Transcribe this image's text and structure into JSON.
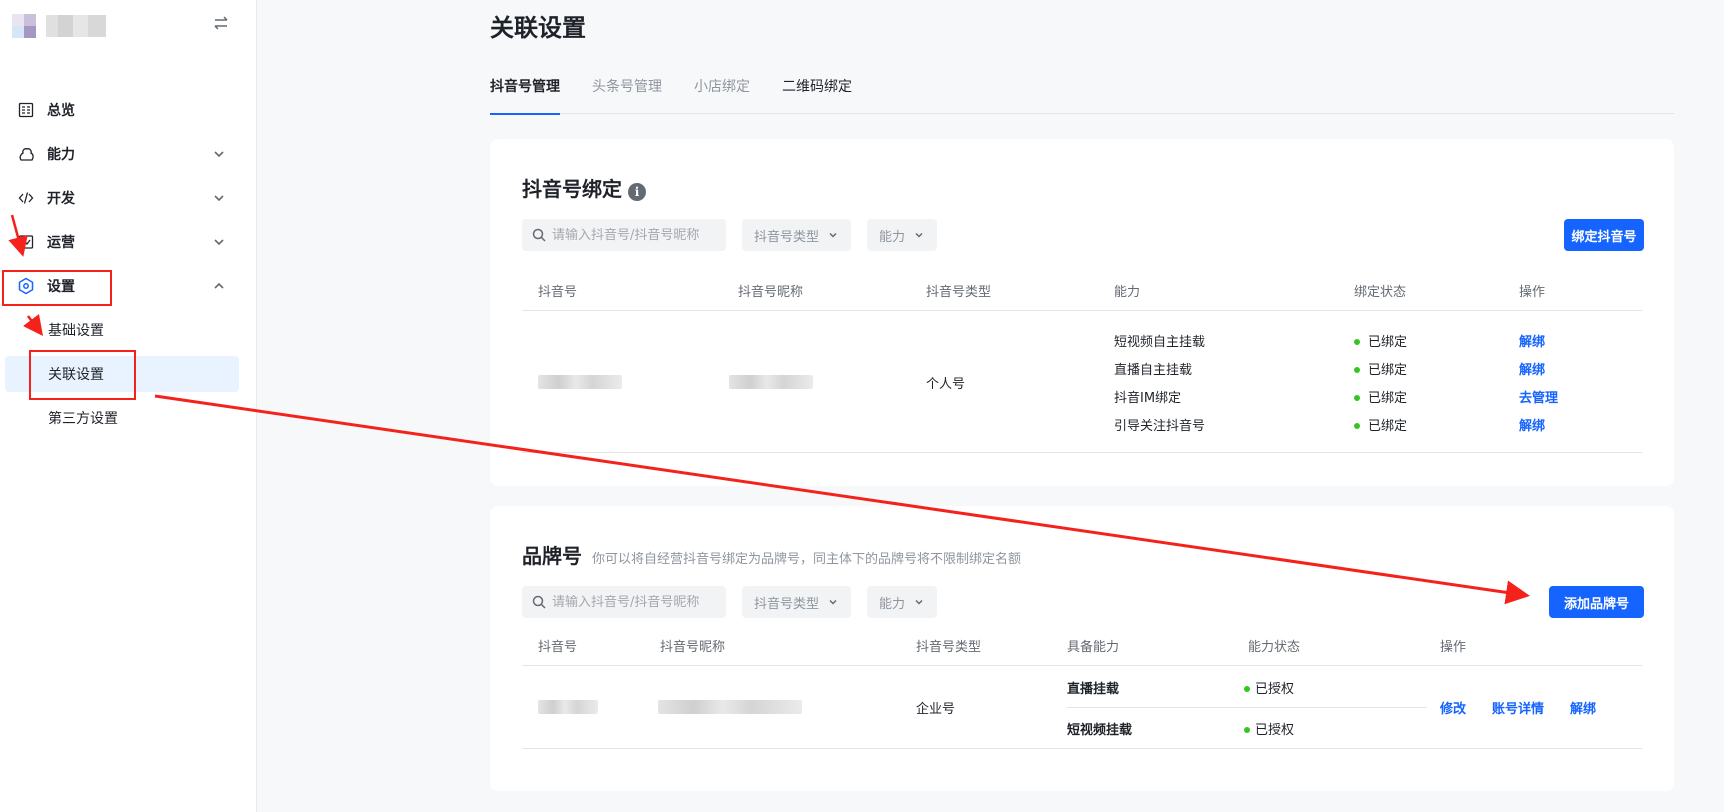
{
  "sidebar": {
    "collapse_icon": "swap-arrows-icon",
    "nav": [
      {
        "label": "总览",
        "icon": "dashboard-icon"
      },
      {
        "label": "能力",
        "icon": "ability-icon"
      },
      {
        "label": "开发",
        "icon": "code-icon"
      },
      {
        "label": "运营",
        "icon": "operation-icon"
      },
      {
        "label": "设置",
        "icon": "settings-icon"
      }
    ],
    "sub_items": [
      "基础设置",
      "关联设置",
      "第三方设置"
    ]
  },
  "page": {
    "title": "关联设置",
    "tabs": [
      "抖音号管理",
      "头条号管理",
      "小店绑定",
      "二维码绑定"
    ],
    "active_tab": "抖音号管理"
  },
  "douyin_card": {
    "title": "抖音号绑定",
    "info_icon": "i",
    "search_placeholder": "请输入抖音号/抖音号昵称",
    "filter_type": "抖音号类型",
    "filter_ability": "能力",
    "bind_button": "绑定抖音号",
    "columns": [
      "抖音号",
      "抖音号昵称",
      "抖音号类型",
      "能力",
      "绑定状态",
      "操作"
    ],
    "row": {
      "type": "个人号",
      "abilities": [
        {
          "ability": "短视频自主挂载",
          "status": "已绑定",
          "action": "解绑"
        },
        {
          "ability": "直播自主挂载",
          "status": "已绑定",
          "action": "解绑"
        },
        {
          "ability": "抖音IM绑定",
          "status": "已绑定",
          "action": "去管理"
        },
        {
          "ability": "引导关注抖音号",
          "status": "已绑定",
          "action": "解绑"
        }
      ]
    }
  },
  "brand_card": {
    "title": "品牌号",
    "description": "你可以将自经营抖音号绑定为品牌号，同主体下的品牌号将不限制绑定名额",
    "search_placeholder": "请输入抖音号/抖音号昵称",
    "filter_type": "抖音号类型",
    "filter_ability": "能力",
    "add_button": "添加品牌号",
    "columns": [
      "抖音号",
      "抖音号昵称",
      "抖音号类型",
      "具备能力",
      "能力状态",
      "操作"
    ],
    "row": {
      "type": "企业号",
      "abilities": [
        {
          "ability": "直播挂载",
          "status": "已授权"
        },
        {
          "ability": "短视频挂载",
          "status": "已授权"
        }
      ],
      "actions": [
        "修改",
        "账号详情",
        "解绑"
      ]
    }
  },
  "colors": {
    "accent": "#1664ff",
    "annotation": "#f5221b",
    "status_ok": "#34c724"
  }
}
